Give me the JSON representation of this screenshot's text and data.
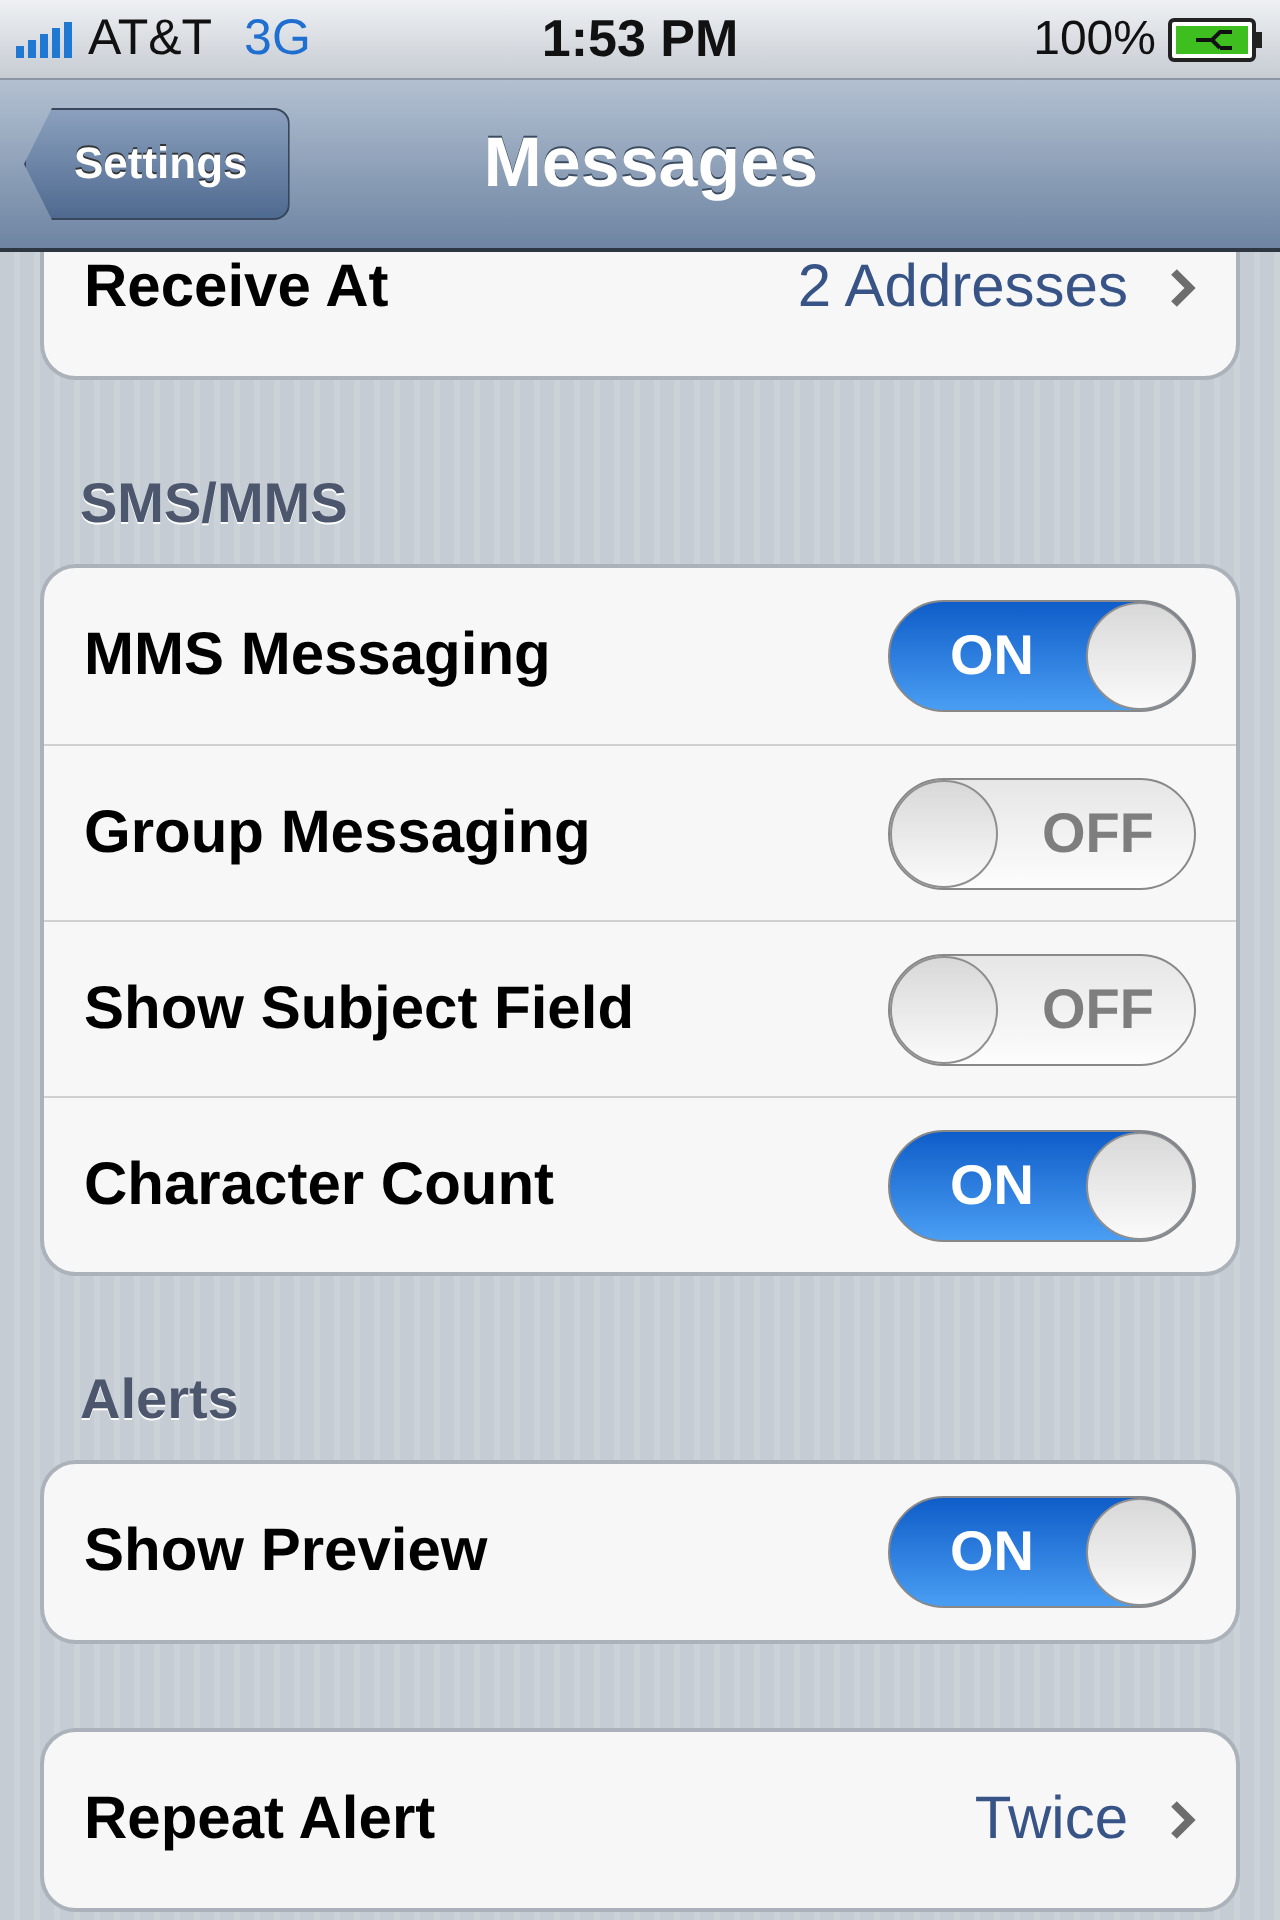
{
  "status_bar": {
    "carrier": "AT&T",
    "network": "3G",
    "time": "1:53 PM",
    "battery": "100%"
  },
  "nav": {
    "back": "Settings",
    "title": "Messages"
  },
  "groups": [
    {
      "rows": [
        {
          "kind": "disclosure",
          "label": "Receive At",
          "value": "2 Addresses"
        }
      ]
    },
    {
      "header": "SMS/MMS",
      "rows": [
        {
          "kind": "toggle",
          "label": "MMS Messaging",
          "on": true,
          "state_label": "ON"
        },
        {
          "kind": "toggle",
          "label": "Group Messaging",
          "on": false,
          "state_label": "OFF"
        },
        {
          "kind": "toggle",
          "label": "Show Subject Field",
          "on": false,
          "state_label": "OFF"
        },
        {
          "kind": "toggle",
          "label": "Character Count",
          "on": true,
          "state_label": "ON"
        }
      ]
    },
    {
      "header": "Alerts",
      "rows": [
        {
          "kind": "toggle",
          "label": "Show Preview",
          "on": true,
          "state_label": "ON"
        }
      ]
    },
    {
      "rows": [
        {
          "kind": "disclosure",
          "label": "Repeat Alert",
          "value": "Twice"
        }
      ]
    }
  ]
}
